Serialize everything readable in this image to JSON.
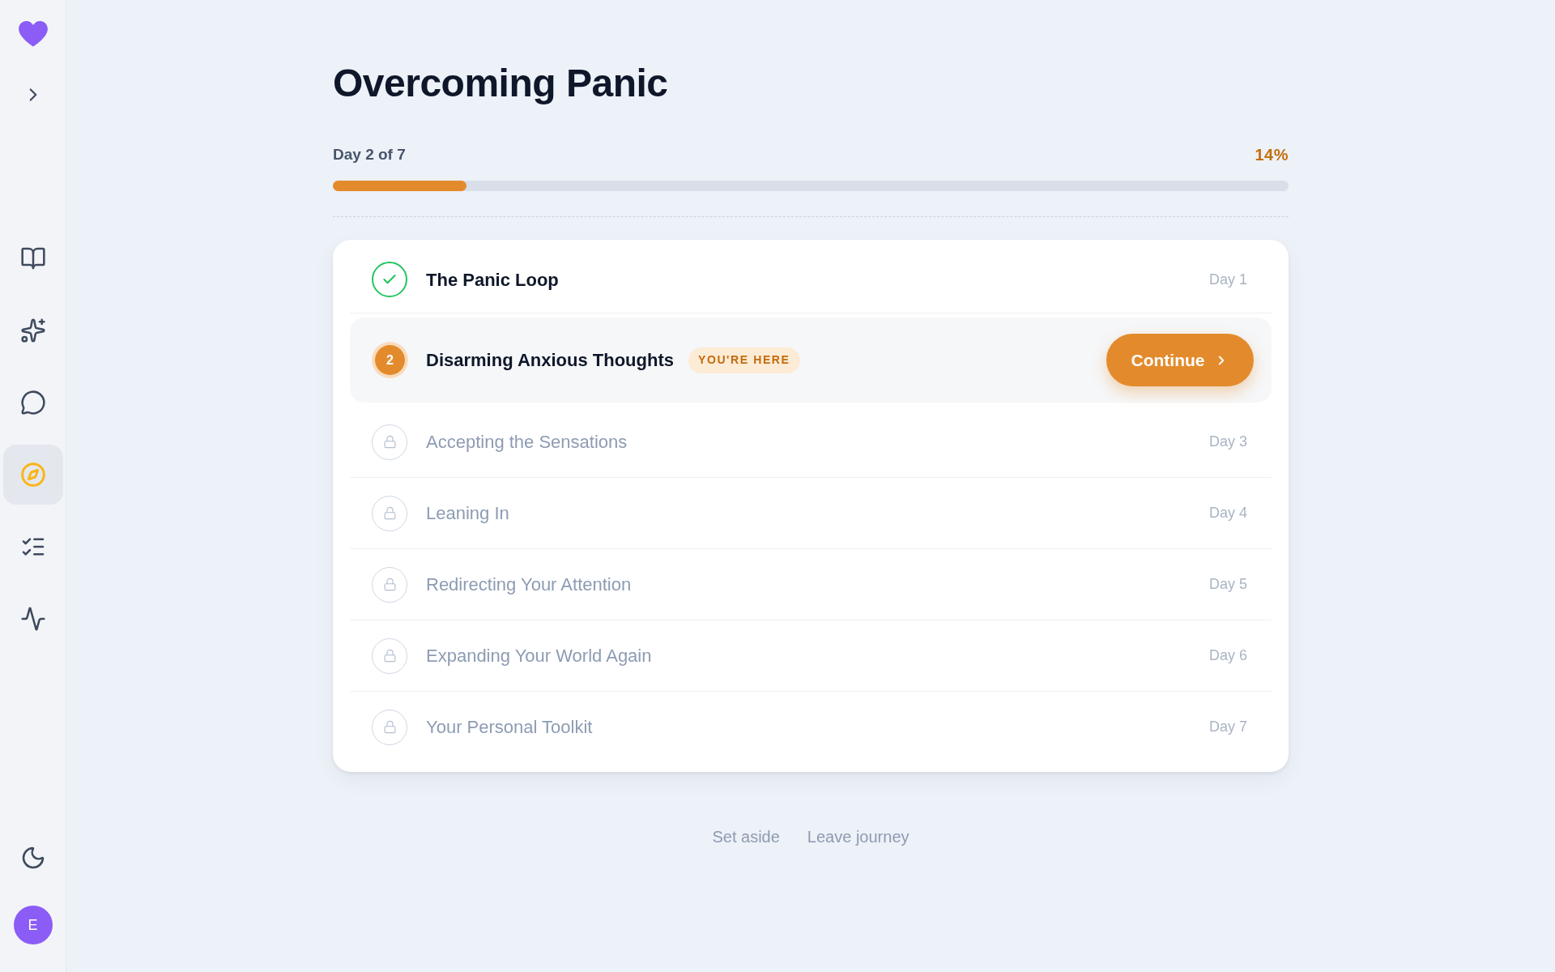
{
  "sidebar": {
    "nav": [
      {
        "selected": false
      },
      {
        "selected": false
      },
      {
        "selected": false
      },
      {
        "selected": true
      },
      {
        "selected": false
      },
      {
        "selected": false
      }
    ],
    "avatar": {
      "initial": "E"
    }
  },
  "journey": {
    "title": "Overcoming Panic",
    "progress_label": "Day 2 of 7",
    "percent": "14%",
    "level": 0.14
  },
  "lessons": [
    {
      "kind": "done",
      "title": "The Panic Loop",
      "day": "Day 1"
    },
    {
      "kind": "current",
      "number": "2",
      "title": "Disarming Anxious Thoughts",
      "badge": "YOU'RE HERE",
      "action": "Continue"
    },
    {
      "kind": "locked",
      "title": "Accepting the Sensations",
      "day": "Day 3"
    },
    {
      "kind": "locked",
      "title": "Leaning In",
      "day": "Day 4"
    },
    {
      "kind": "locked",
      "title": "Redirecting Your Attention",
      "day": "Day 5"
    },
    {
      "kind": "locked",
      "title": "Expanding Your World Again",
      "day": "Day 6"
    },
    {
      "kind": "locked",
      "title": "Your Personal Toolkit",
      "day": "Day 7"
    }
  ],
  "footer_links": [
    "Set aside",
    "Leave journey"
  ]
}
